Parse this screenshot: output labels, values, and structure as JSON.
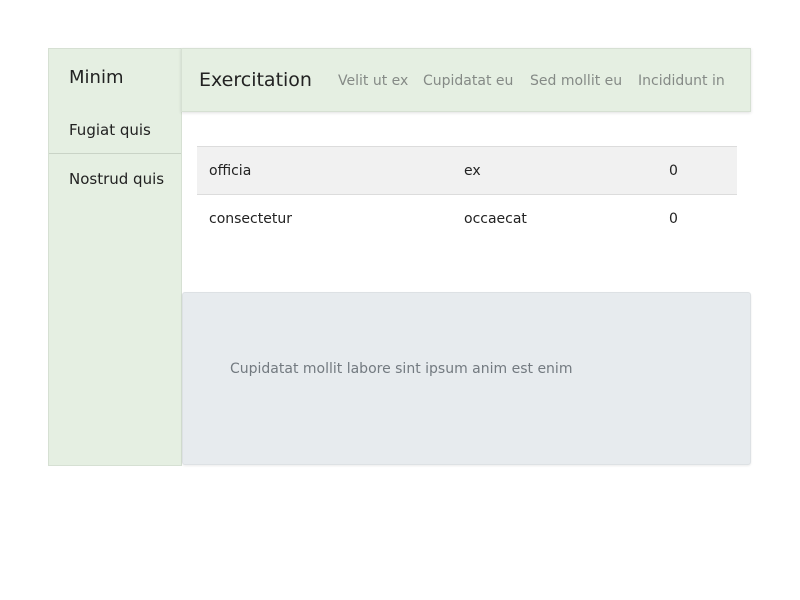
{
  "sidebar": {
    "title": "Minim",
    "items": [
      {
        "label": "Fugiat quis"
      },
      {
        "label": "Nostrud quis"
      }
    ]
  },
  "header": {
    "title": "Exercitation",
    "nav": [
      {
        "label": "Velit ut ex"
      },
      {
        "label": "Cupidatat eu"
      },
      {
        "label": "Sed mollit eu"
      },
      {
        "label": "Incididunt in"
      }
    ]
  },
  "table": {
    "rows": [
      [
        "officia",
        "ex",
        "0"
      ],
      [
        "consectetur",
        "occaecat",
        "0"
      ]
    ]
  },
  "card": {
    "text": "Cupidatat mollit labore sint ipsum anim est enim"
  },
  "colors": {
    "panel_green": "#e5efe2",
    "card_gray": "#e7ebee",
    "nav_text": "#858a86"
  }
}
